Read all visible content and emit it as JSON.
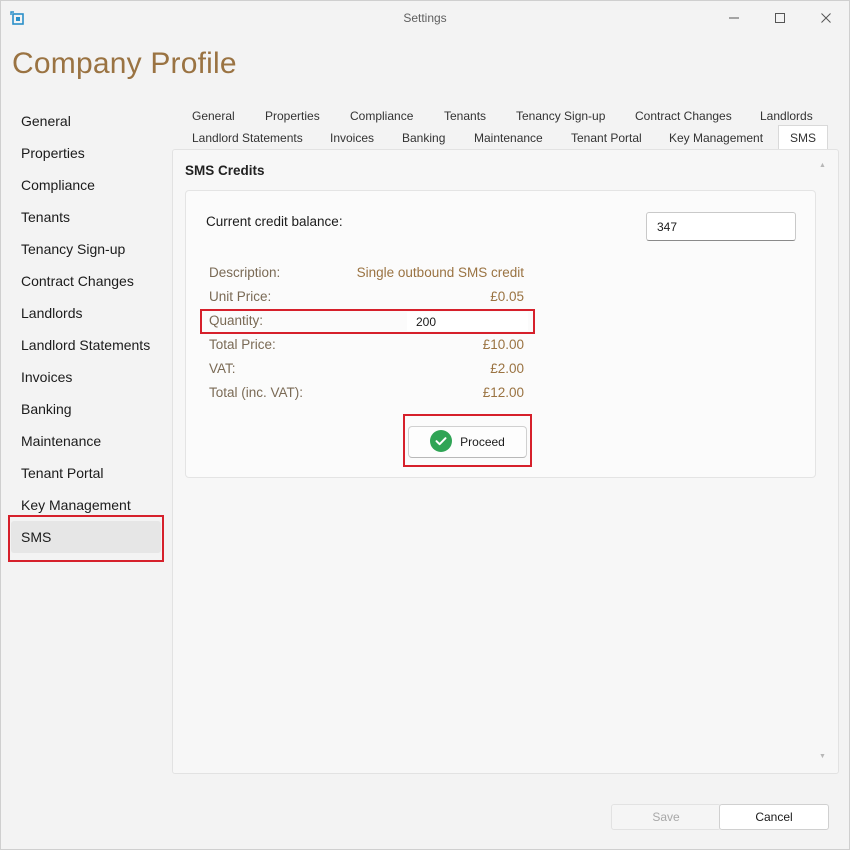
{
  "window": {
    "title": "Settings"
  },
  "page_title": "Company Profile",
  "left_nav": {
    "items": [
      {
        "label": "General"
      },
      {
        "label": "Properties"
      },
      {
        "label": "Compliance"
      },
      {
        "label": "Tenants"
      },
      {
        "label": "Tenancy Sign-up"
      },
      {
        "label": "Contract Changes"
      },
      {
        "label": "Landlords"
      },
      {
        "label": "Landlord Statements"
      },
      {
        "label": "Invoices"
      },
      {
        "label": "Banking"
      },
      {
        "label": "Maintenance"
      },
      {
        "label": "Tenant Portal"
      },
      {
        "label": "Key Management"
      },
      {
        "label": "SMS"
      }
    ],
    "selected": "SMS"
  },
  "tabs": {
    "row1": [
      "General",
      "Properties",
      "Compliance",
      "Tenants",
      "Tenancy Sign-up",
      "Contract Changes",
      "Landlords"
    ],
    "row2": [
      "Landlord Statements",
      "Invoices",
      "Banking",
      "Maintenance",
      "Tenant Portal",
      "Key Management",
      "SMS"
    ],
    "active": "SMS"
  },
  "sms": {
    "section_title": "SMS Credits",
    "balance_label": "Current credit balance:",
    "balance_value": "347",
    "rows": {
      "description": {
        "label": "Description:",
        "value": "Single outbound SMS credit"
      },
      "unit_price": {
        "label": "Unit Price:",
        "value": "£0.05"
      },
      "quantity": {
        "label": "Quantity:",
        "value": "200"
      },
      "total_price": {
        "label": "Total Price:",
        "value": "£10.00"
      },
      "vat": {
        "label": "VAT:",
        "value": "£2.00"
      },
      "total_inc_vat": {
        "label": "Total (inc. VAT):",
        "value": "£12.00"
      }
    },
    "proceed_label": "Proceed"
  },
  "footer": {
    "save_label": "Save",
    "cancel_label": "Cancel"
  },
  "colors": {
    "accent": "#9a7342",
    "highlight": "#d6202b",
    "success": "#2fa455"
  }
}
